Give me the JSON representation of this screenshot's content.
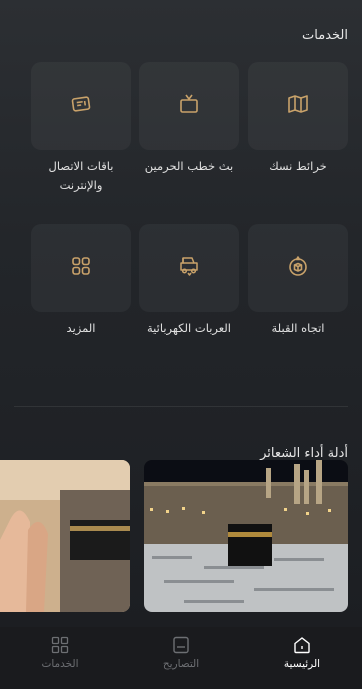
{
  "services_section": {
    "title": "الخدمات",
    "tiles": [
      {
        "label": "خرائط نسك",
        "icon": "map-icon"
      },
      {
        "label": "بث خطب الحرمين",
        "icon": "tv-icon"
      },
      {
        "label": "باقات الاتصال والإنترنت",
        "icon": "sim-card-icon"
      },
      {
        "label": "اتجاه القبلة",
        "icon": "qibla-compass-icon"
      },
      {
        "label": "العربات الكهربائية",
        "icon": "electric-cart-icon"
      },
      {
        "label": "المزيد",
        "icon": "grid-icon"
      }
    ]
  },
  "guides_section": {
    "title": "أدلة أداء الشعائر"
  },
  "tabbar": {
    "items": [
      {
        "label": "الرئيسية",
        "icon": "home-icon",
        "active": true
      },
      {
        "label": "التصاريح",
        "icon": "permits-icon",
        "active": false
      },
      {
        "label": "الخدمات",
        "icon": "services-grid-icon",
        "active": false
      }
    ]
  },
  "colors": {
    "accent_gold": "#c9a26a",
    "active_tab": "#ffffff",
    "inactive_tab": "#6d6f73"
  }
}
